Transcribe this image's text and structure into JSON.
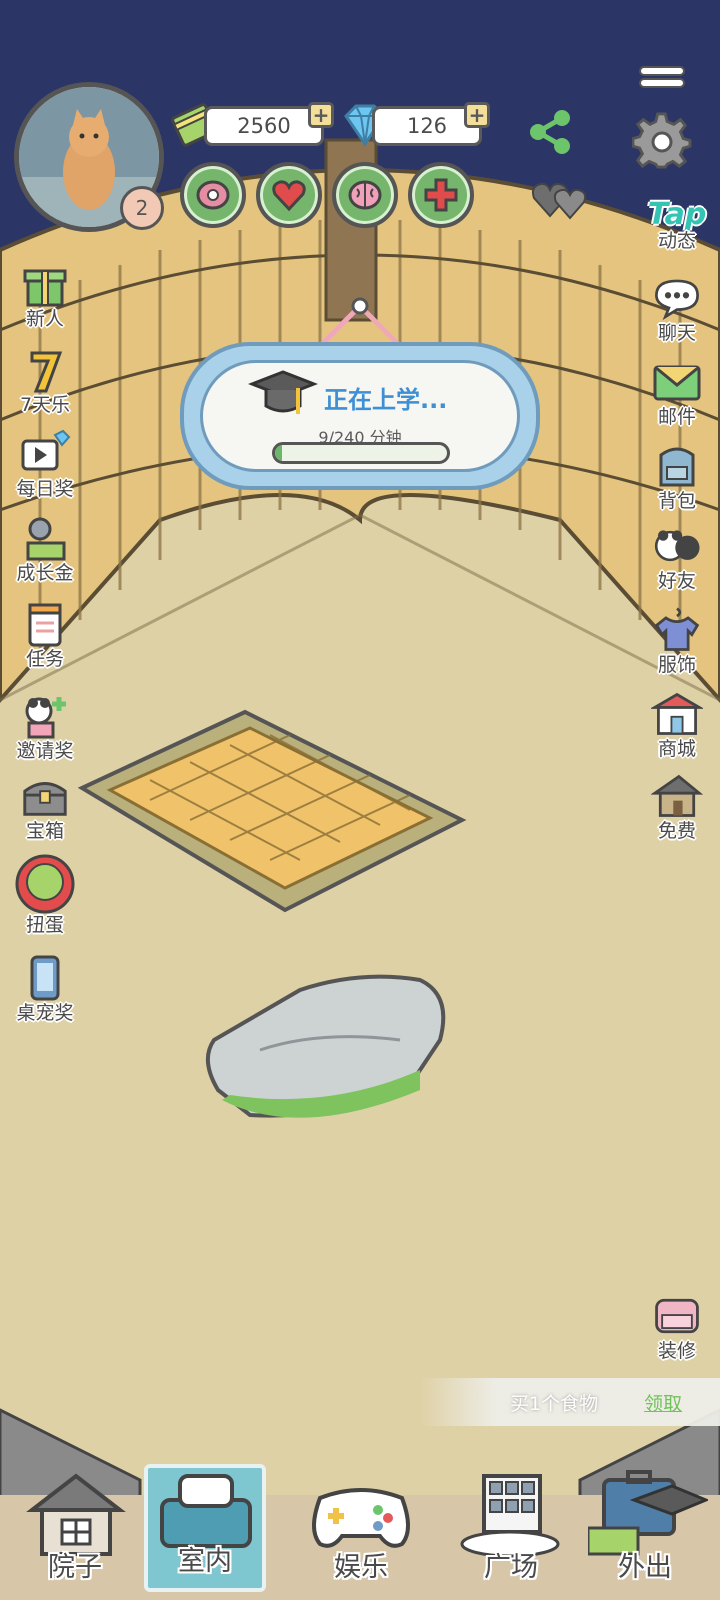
{
  "profile": {
    "level": "2"
  },
  "currency": {
    "money": "2560",
    "diamonds": "126",
    "plus": "+"
  },
  "top_right": {
    "tap_logo": "Tap"
  },
  "left_menu": [
    {
      "label": "新人",
      "icon": "gift-icon"
    },
    {
      "label": "7天乐",
      "icon": "seven-days-icon"
    },
    {
      "label": "每日奖",
      "icon": "video-diamond-icon"
    },
    {
      "label": "成长金",
      "icon": "growth-fund-icon"
    },
    {
      "label": "任务",
      "icon": "task-clipboard-icon"
    },
    {
      "label": "邀请奖",
      "icon": "invite-reward-icon"
    },
    {
      "label": "宝箱",
      "icon": "treasure-chest-icon"
    },
    {
      "label": "扭蛋",
      "icon": "gacha-icon"
    },
    {
      "label": "桌宠奖",
      "icon": "desktop-pet-icon"
    }
  ],
  "right_menu": [
    {
      "label": "动态",
      "icon": "tap-moments-icon"
    },
    {
      "label": "聊天",
      "icon": "chat-bubble-icon"
    },
    {
      "label": "邮件",
      "icon": "mail-icon"
    },
    {
      "label": "背包",
      "icon": "backpack-icon"
    },
    {
      "label": "好友",
      "icon": "friends-icon"
    },
    {
      "label": "服饰",
      "icon": "clothing-icon"
    },
    {
      "label": "商城",
      "icon": "shop-icon"
    },
    {
      "label": "免费",
      "icon": "free-house-icon"
    },
    {
      "label": "装修",
      "icon": "decor-sofa-icon"
    }
  ],
  "school": {
    "title": "正在上学...",
    "time": "9/240 分钟",
    "progress": 0.04
  },
  "reward": {
    "text": "买1个食物",
    "link": "领取"
  },
  "nav": [
    {
      "label": "院子",
      "icon": "yard-house-icon"
    },
    {
      "label": "室内",
      "icon": "indoor-bed-icon"
    },
    {
      "label": "娱乐",
      "icon": "gamepad-icon"
    },
    {
      "label": "广场",
      "icon": "plaza-building-icon"
    },
    {
      "label": "外出",
      "icon": "outing-suitcase-icon"
    }
  ],
  "colors": {
    "sky": "#2c3666",
    "floor": "#dfd1a6",
    "straw": "#e4c47f",
    "accent_green": "#75b56c",
    "banner_blue": "#3e8fd4"
  }
}
